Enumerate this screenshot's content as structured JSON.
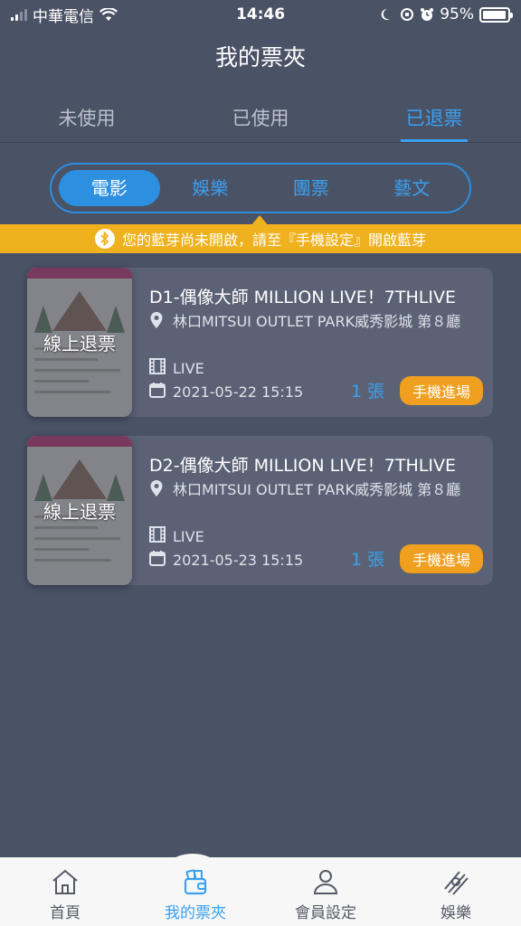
{
  "status_bar": {
    "carrier": "中華電信",
    "time": "14:46",
    "battery": "95%"
  },
  "header": {
    "title": "我的票夾"
  },
  "tabs": [
    {
      "label": "未使用"
    },
    {
      "label": "已使用"
    },
    {
      "label": "已退票"
    }
  ],
  "segments": [
    {
      "label": "電影"
    },
    {
      "label": "娛樂"
    },
    {
      "label": "團票"
    },
    {
      "label": "藝文"
    }
  ],
  "banner": {
    "text": "您的藍芽尚未開啟，請至『手機設定』開啟藍芽"
  },
  "tickets": [
    {
      "thumb_label": "線上退票",
      "title": "D1-偶像大師 MILLION LIVE！7THLIVE",
      "venue": "林口MITSUI OUTLET PARK威秀影城 第８廳",
      "format": "LIVE",
      "datetime": "2021-05-22 15:15",
      "count": "1 張",
      "action": "手機進場"
    },
    {
      "thumb_label": "線上退票",
      "title": "D2-偶像大師 MILLION LIVE！7THLIVE",
      "venue": "林口MITSUI OUTLET PARK威秀影城 第８廳",
      "format": "LIVE",
      "datetime": "2021-05-23 15:15",
      "count": "1 張",
      "action": "手機進場"
    }
  ],
  "bottom_nav": [
    {
      "label": "首頁",
      "icon": "home-icon"
    },
    {
      "label": "我的票夾",
      "icon": "wallet-icon"
    },
    {
      "label": "會員設定",
      "icon": "user-icon"
    },
    {
      "label": "娛樂",
      "icon": "entertainment-icon"
    }
  ],
  "colors": {
    "background": "#4a5266",
    "accent": "#3aa0f0",
    "banner": "#f0b11e",
    "button": "#f0a01e"
  }
}
